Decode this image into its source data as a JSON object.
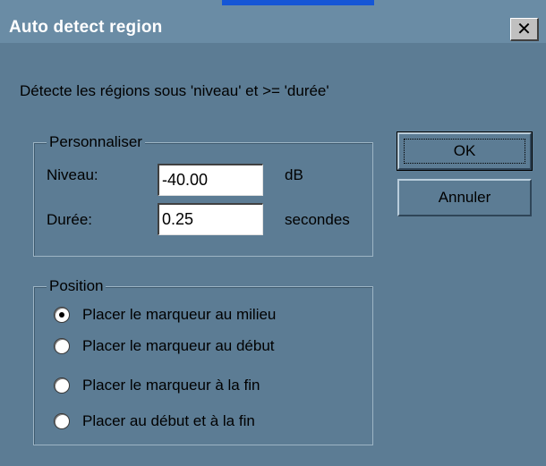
{
  "window": {
    "title": "Auto detect region",
    "close_glyph": "✕"
  },
  "description": "Détecte les régions sous 'niveau' et >=  'durée'",
  "custom": {
    "legend": "Personnaliser",
    "level_label": "Niveau:",
    "level_value": "-40.00",
    "level_unit": "dB",
    "duration_label": "Durée:",
    "duration_value": "0.25",
    "duration_unit": "secondes"
  },
  "position": {
    "legend": "Position",
    "selected_index": 0,
    "options": [
      "Placer le marqueur au milieu",
      "Placer le marqueur au début",
      "Placer le marqueur à la fin",
      "Placer au début et à la fin"
    ]
  },
  "buttons": {
    "ok_label": "OK",
    "cancel_label": "Annuler"
  },
  "colors": {
    "dialog_bg": "#5C7C94",
    "titlebar_bg": "#6A8CA5",
    "accent": "#1556D6"
  }
}
